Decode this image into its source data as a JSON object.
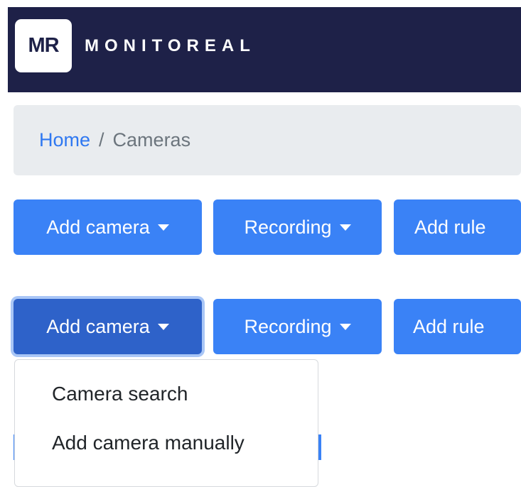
{
  "navbar": {
    "logo_mark": "MR",
    "brand_text": "MONITOREAL",
    "background": "#1e2148"
  },
  "breadcrumb": {
    "home": "Home",
    "separator": "/",
    "current": "Cameras"
  },
  "toolbar_row1": {
    "add_camera": "Add camera",
    "recording": "Recording",
    "add_rule": "Add rule"
  },
  "toolbar_row2": {
    "add_camera": "Add camera",
    "recording": "Recording",
    "add_rule": "Add rule"
  },
  "add_camera_menu": {
    "items": [
      "Camera search",
      "Add camera manually"
    ]
  },
  "colors": {
    "primary": "#3a82f6",
    "primary_active": "#2e62c9",
    "link": "#2f78f1",
    "breadcrumb_bg": "#e9ecef"
  }
}
